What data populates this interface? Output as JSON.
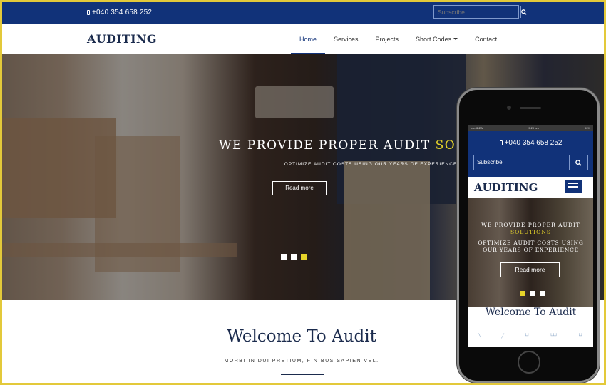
{
  "topbar": {
    "phone_icon": "mobile-phone-icon",
    "phone": "+040 354 658 252",
    "subscribe_placeholder": "Subscribe",
    "search_icon": "search-icon"
  },
  "nav": {
    "logo": "AUDITING",
    "items": [
      {
        "label": "Home",
        "active": true
      },
      {
        "label": "Services"
      },
      {
        "label": "Projects"
      },
      {
        "label": "Short Codes",
        "dropdown": true
      },
      {
        "label": "Contact"
      }
    ]
  },
  "hero": {
    "title_main": "WE PROVIDE PROPER AUDIT ",
    "title_highlight": "SOLUTIONS",
    "subtitle": "OPTIMIZE AUDIT COSTS USING OUR YEARS OF EXPERIENCE",
    "button": "Read more",
    "slides": 3,
    "active_slide": 3
  },
  "welcome": {
    "title": "Welcome To Audit",
    "subtitle": "MORBI IN DUI PRETIUM, FINIBUS SAPIEN VEL."
  },
  "mobile": {
    "status_left": "•••• IDEA",
    "status_time": "9:20 pm",
    "status_right": "90%",
    "phone": "+040 354 658 252",
    "subscribe_placeholder": "Subscribe",
    "logo": "AUDITING",
    "title_main": "WE PROVIDE PROPER AUDIT",
    "title_highlight": "SOLUTIONS",
    "subtitle": "OPTIMIZE AUDIT COSTS USING OUR YEARS OF EXPERIENCE",
    "button": "Read more",
    "active_slide": 1,
    "welcome": "Welcome To Audit"
  },
  "colors": {
    "primary": "#113279",
    "accent": "#e6d42a",
    "frame": "#e3c93a",
    "heading": "#1b2b4d"
  }
}
